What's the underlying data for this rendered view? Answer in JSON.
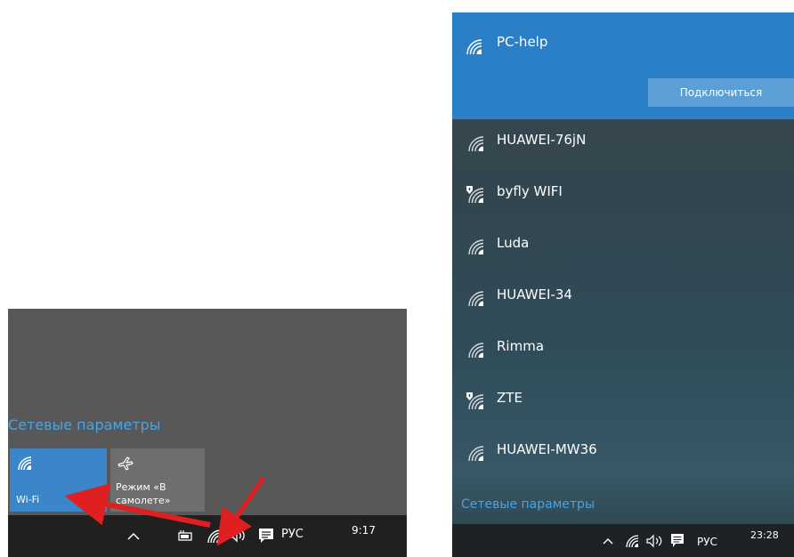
{
  "left": {
    "settings_link": "Сетевые параметры",
    "wifi_tile": {
      "label": "Wi-Fi",
      "icon": "wifi-icon",
      "active_color": "#3a86c8"
    },
    "airplane_tile": {
      "label": "Режим «В самолете»",
      "icon": "airplane-icon"
    },
    "taskbar": {
      "icons": [
        "chevron-up-icon",
        "battery-plug-icon",
        "wifi-icon",
        "volume-icon",
        "notification-icon"
      ],
      "language": "РУС",
      "time": "9:17"
    },
    "arrow_color": "#e02020"
  },
  "right": {
    "selected_network": {
      "name": "PC-help",
      "connect_label": "Подключиться",
      "icon": "wifi-icon",
      "highlight_color": "#2a7fc6"
    },
    "networks": [
      {
        "name": "HUAWEI-76jN",
        "secured": false
      },
      {
        "name": "byfly WIFI",
        "secured": true
      },
      {
        "name": "Luda",
        "secured": false
      },
      {
        "name": "HUAWEI-34",
        "secured": false
      },
      {
        "name": "Rimma",
        "secured": false
      },
      {
        "name": "ZTE",
        "secured": true
      },
      {
        "name": "HUAWEI-MW36",
        "secured": false
      }
    ],
    "settings_link": "Сетевые параметры",
    "taskbar": {
      "icons": [
        "chevron-up-icon",
        "wifi-icon",
        "volume-icon",
        "notification-icon"
      ],
      "language": "РУС",
      "time": "23:28"
    }
  }
}
